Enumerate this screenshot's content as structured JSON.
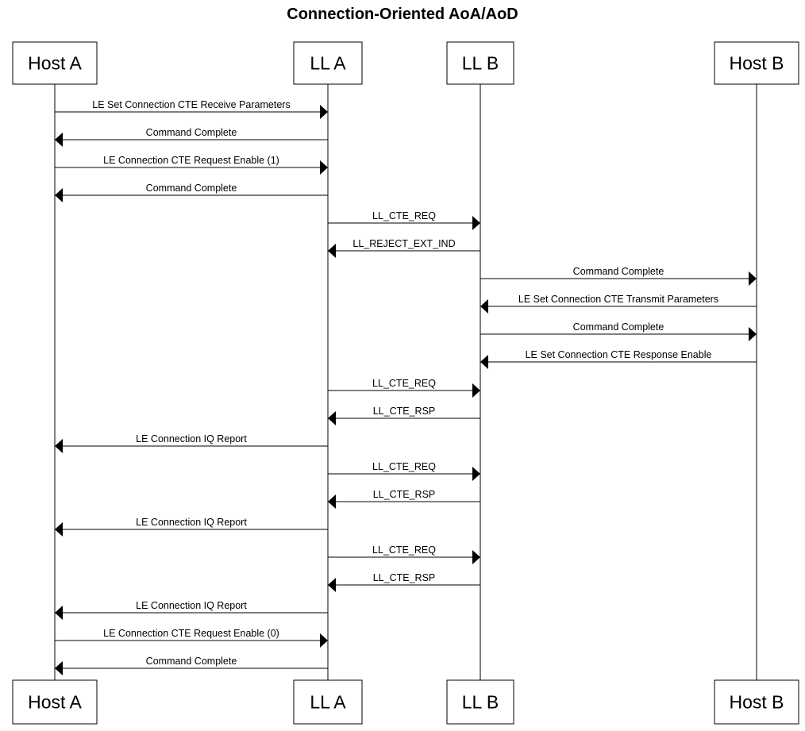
{
  "diagram": {
    "type": "sequence",
    "title": "Connection-Oriented AoA/AoD",
    "actors": [
      {
        "id": "hostA",
        "label": "Host A"
      },
      {
        "id": "llA",
        "label": "LL A"
      },
      {
        "id": "llB",
        "label": "LL B"
      },
      {
        "id": "hostB",
        "label": "Host B"
      }
    ],
    "messages": [
      {
        "from": "hostA",
        "to": "llA",
        "label": "LE Set Connection CTE Receive Parameters"
      },
      {
        "from": "llA",
        "to": "hostA",
        "label": "Command Complete"
      },
      {
        "from": "hostA",
        "to": "llA",
        "label": "LE Connection CTE Request Enable (1)"
      },
      {
        "from": "llA",
        "to": "hostA",
        "label": "Command Complete"
      },
      {
        "from": "llA",
        "to": "llB",
        "label": "LL_CTE_REQ"
      },
      {
        "from": "llB",
        "to": "llA",
        "label": "LL_REJECT_EXT_IND"
      },
      {
        "from": "llB",
        "to": "hostB",
        "label": "Command Complete"
      },
      {
        "from": "hostB",
        "to": "llB",
        "label": "LE Set Connection CTE Transmit Parameters"
      },
      {
        "from": "llB",
        "to": "hostB",
        "label": "Command Complete"
      },
      {
        "from": "hostB",
        "to": "llB",
        "label": "LE Set Connection CTE Response Enable"
      },
      {
        "from": "llA",
        "to": "llB",
        "label": "LL_CTE_REQ"
      },
      {
        "from": "llB",
        "to": "llA",
        "label": "LL_CTE_RSP"
      },
      {
        "from": "llA",
        "to": "hostA",
        "label": "LE Connection IQ Report"
      },
      {
        "from": "llA",
        "to": "llB",
        "label": "LL_CTE_REQ"
      },
      {
        "from": "llB",
        "to": "llA",
        "label": "LL_CTE_RSP"
      },
      {
        "from": "llA",
        "to": "hostA",
        "label": "LE Connection IQ Report"
      },
      {
        "from": "llA",
        "to": "llB",
        "label": "LL_CTE_REQ"
      },
      {
        "from": "llB",
        "to": "llA",
        "label": "LL_CTE_RSP"
      },
      {
        "from": "llA",
        "to": "hostA",
        "label": "LE Connection IQ Report"
      },
      {
        "from": "hostA",
        "to": "llA",
        "label": "LE Connection CTE Request Enable (0)"
      },
      {
        "from": "llA",
        "to": "hostA",
        "label": "Command Complete"
      }
    ]
  }
}
